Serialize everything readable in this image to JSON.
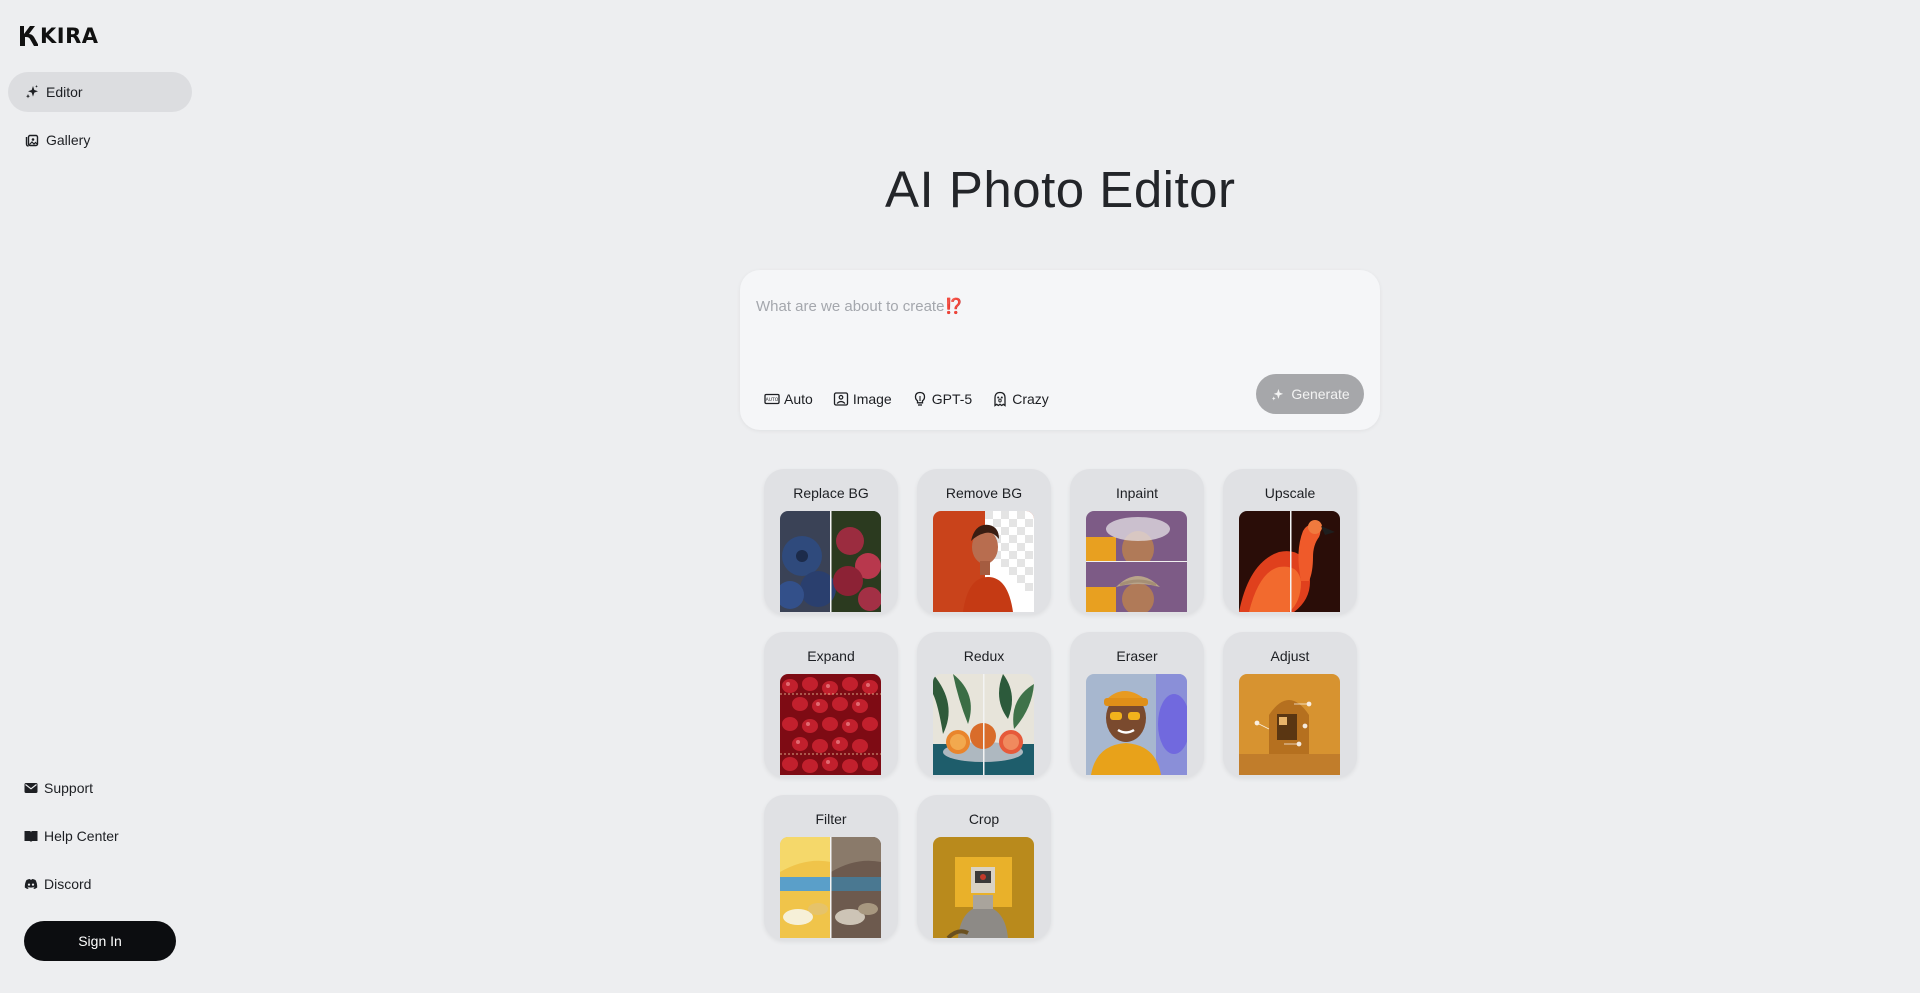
{
  "brand": {
    "name": "KIRA"
  },
  "sidebar": {
    "nav": [
      {
        "label": "Editor",
        "icon": "sparkle-icon",
        "active": true
      },
      {
        "label": "Gallery",
        "icon": "gallery-icon",
        "active": false
      }
    ],
    "footer": [
      {
        "label": "Support",
        "icon": "mail-icon"
      },
      {
        "label": "Help Center",
        "icon": "book-icon"
      },
      {
        "label": "Discord",
        "icon": "discord-icon"
      }
    ],
    "signin_label": "Sign In"
  },
  "main": {
    "title": "AI Photo Editor",
    "prompt": {
      "placeholder": "What are we about to create⁉️",
      "value": "",
      "options": [
        {
          "label": "Auto",
          "icon": "aspect-ratio-icon"
        },
        {
          "label": "Image",
          "icon": "image-icon"
        },
        {
          "label": "GPT-5",
          "icon": "lightbulb-icon"
        },
        {
          "label": "Crazy",
          "icon": "ghost-icon"
        }
      ],
      "generate_label": "Generate"
    },
    "tools": [
      {
        "label": "Replace BG"
      },
      {
        "label": "Remove BG"
      },
      {
        "label": "Inpaint"
      },
      {
        "label": "Upscale"
      },
      {
        "label": "Expand"
      },
      {
        "label": "Redux"
      },
      {
        "label": "Eraser"
      },
      {
        "label": "Adjust"
      },
      {
        "label": "Filter"
      },
      {
        "label": "Crop"
      }
    ]
  },
  "colors": {
    "background": "#edeef0",
    "active_nav": "#dcdde0",
    "signin_bg": "#0c0d10",
    "generate_bg": "#a6a7aa",
    "tool_card": "#e0e1e4"
  }
}
